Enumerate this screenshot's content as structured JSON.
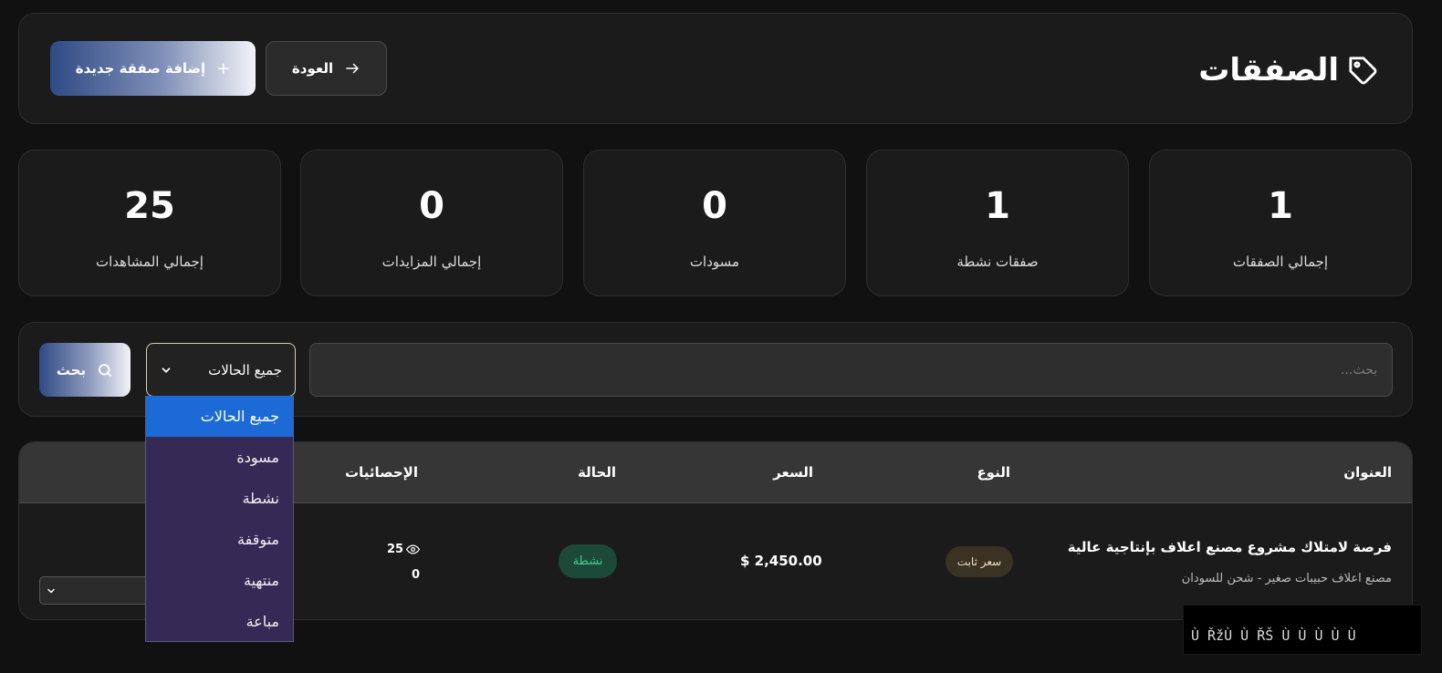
{
  "header": {
    "title": "الصفقات",
    "back_label": "العودة",
    "add_label": "إضافة صفقة جديدة"
  },
  "stats": [
    {
      "value": "1",
      "label": "إجمالي الصفقات"
    },
    {
      "value": "1",
      "label": "صفقات نشطة"
    },
    {
      "value": "0",
      "label": "مسودات"
    },
    {
      "value": "0",
      "label": "إجمالي المزايدات"
    },
    {
      "value": "25",
      "label": "إجمالي المشاهدات"
    }
  ],
  "filter": {
    "search_placeholder": "بحث...",
    "status_selected": "جميع الحالات",
    "search_button": "بحث",
    "status_options": [
      "جميع الحالات",
      "مسودة",
      "نشطة",
      "متوقفة",
      "منتهية",
      "مباعة"
    ]
  },
  "table": {
    "headers": {
      "title": "العنوان",
      "type": "النوع",
      "price": "السعر",
      "status": "الحالة",
      "stats": "الإحصائيات"
    },
    "rows": [
      {
        "title": "فرصة لامتلاك مشروع مصنع اعلاف بإنتاجية عالية",
        "subtitle": "مصنع اعلاف حبيبات صغير - شحن للسودان",
        "type": "سعر ثابت",
        "price": "$ 2,450.00",
        "status": "نشطة",
        "views": "25",
        "bids": "0"
      }
    ]
  },
  "garbled_text": "Ù ŘžÙ Ù ŘŠ Ù Ù Ù Ù Ù",
  "colors": {
    "background": "#111111",
    "card": "#1b1b1b",
    "accent_blue": "#2f4a85",
    "dropdown_bg": "#352a55",
    "dropdown_selected": "#1b6ad6",
    "status_active": "#3ecf8e"
  },
  "icons": {
    "title": "tag-icon",
    "back": "arrow-right-icon",
    "add": "plus-icon",
    "search": "search-icon",
    "select": "chevron-down-icon",
    "views": "eye-icon"
  }
}
